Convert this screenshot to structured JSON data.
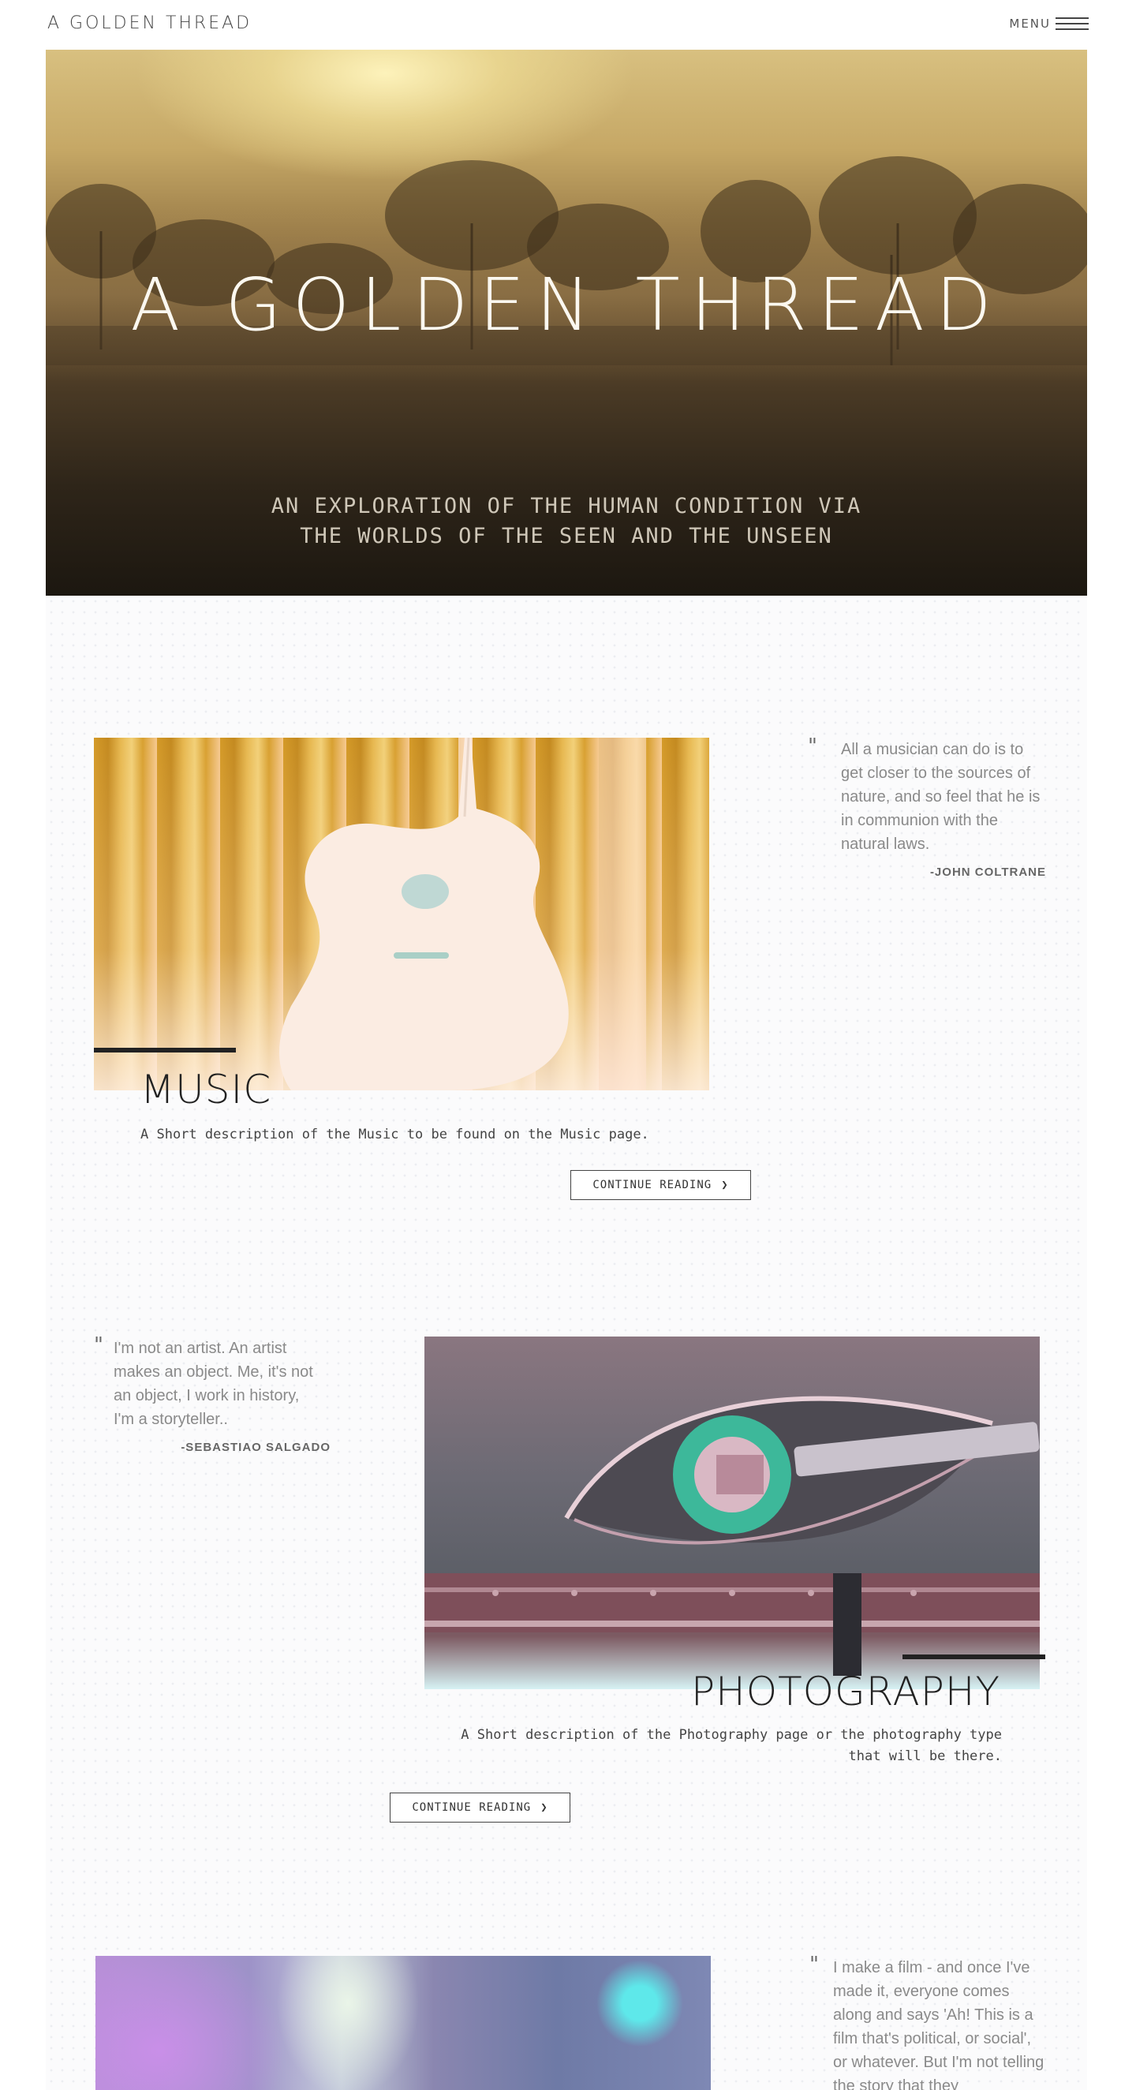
{
  "header": {
    "brand": "A GOLDEN THREAD",
    "menu_label": "MENU",
    "menu_icon": "hamburger-icon"
  },
  "hero": {
    "title": "A GOLDEN THREAD",
    "subtitle": "AN EXPLORATION OF THE HUMAN CONDITION VIA THE WORLDS OF THE SEEN AND THE UNSEEN"
  },
  "sections": [
    {
      "title": "MUSIC",
      "description": "A Short description of the Music to be found on the Music page.",
      "button_label": "CONTINUE READING",
      "button_icon": "chevron-right-icon",
      "quote": {
        "text": "All a musician can do is to get closer to the sources of nature, and so feel that he is in communion with the natural laws.",
        "author": "-JOHN COLTRANE"
      }
    },
    {
      "title": "PHOTOGRAPHY",
      "description": "A Short description of the Photography page or the photography type that will be there.",
      "button_label": "CONTINUE READING",
      "button_icon": "chevron-right-icon",
      "quote": {
        "text": "I'm not an artist. An artist makes an object. Me, it's not an object, I work in history, I'm a storyteller..",
        "author": "-SEBASTIAO SALGADO"
      }
    },
    {
      "quote": {
        "text": "I make a film - and once I've made it, everyone comes along and says 'Ah! This is a film that's political, or social', or whatever. But I'm not telling the story that they"
      }
    }
  ],
  "colors": {
    "accent_bar": "#222222",
    "hero_gold": "#c6a866"
  }
}
